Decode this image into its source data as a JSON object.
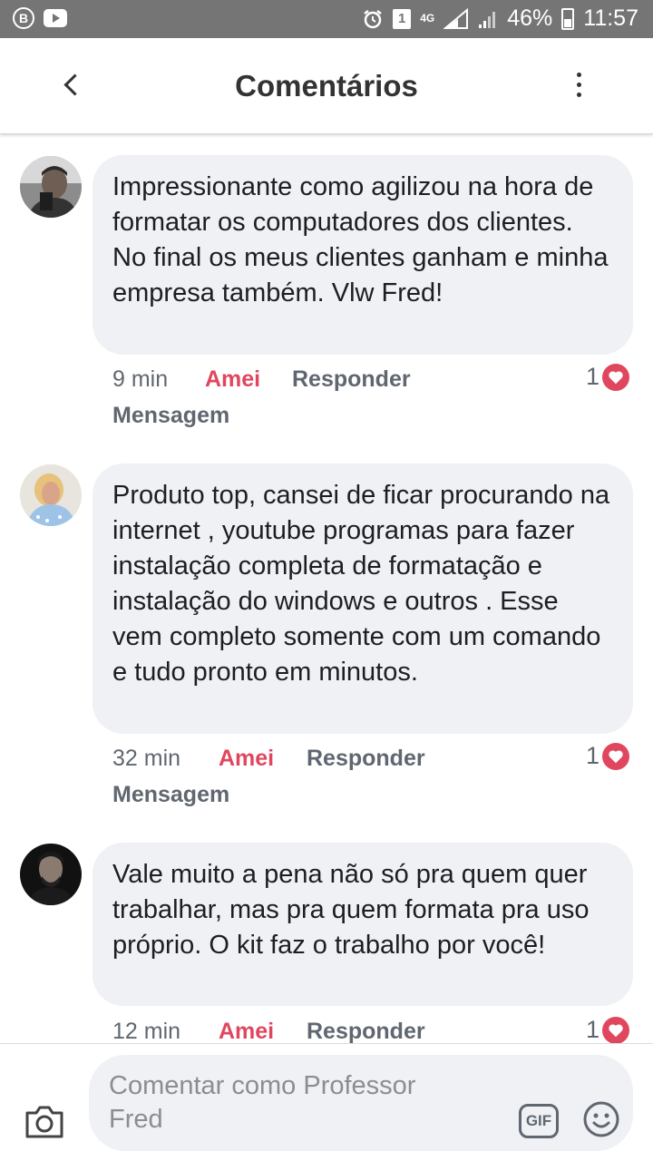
{
  "status_bar": {
    "badge_left": "B",
    "sim": "1",
    "network": "4G",
    "battery": "46%",
    "time": "11:57"
  },
  "header": {
    "title": "Comentários"
  },
  "comments": [
    {
      "text": "Impressionante como agilizou na hora de formatar os computadores dos clientes. No final os meus clientes ganham e minha empresa também. Vlw Fred!",
      "time": "9 min",
      "reaction": "Amei",
      "reply": "Responder",
      "message": "Mensagem",
      "likes": "1"
    },
    {
      "text": "Produto top, cansei de ficar procurando na internet , youtube programas para fazer instalação completa de formatação e instalação do windows e outros . Esse vem completo somente com um comando e tudo pronto em minutos.",
      "time": "32 min",
      "reaction": "Amei",
      "reply": "Responder",
      "message": "Mensagem",
      "likes": "1"
    },
    {
      "text": "Vale muito a pena não só pra quem quer trabalhar, mas pra quem formata pra uso próprio. O kit faz o trabalho por você!",
      "time": "12 min",
      "reaction": "Amei",
      "reply": "Responder",
      "likes": "1"
    }
  ],
  "composer": {
    "placeholder": "Comentar como Professor Fred",
    "gif_label": "GIF"
  },
  "colors": {
    "accent": "#e0475e",
    "bubble": "#f0f1f5",
    "status_bar": "#757575"
  }
}
